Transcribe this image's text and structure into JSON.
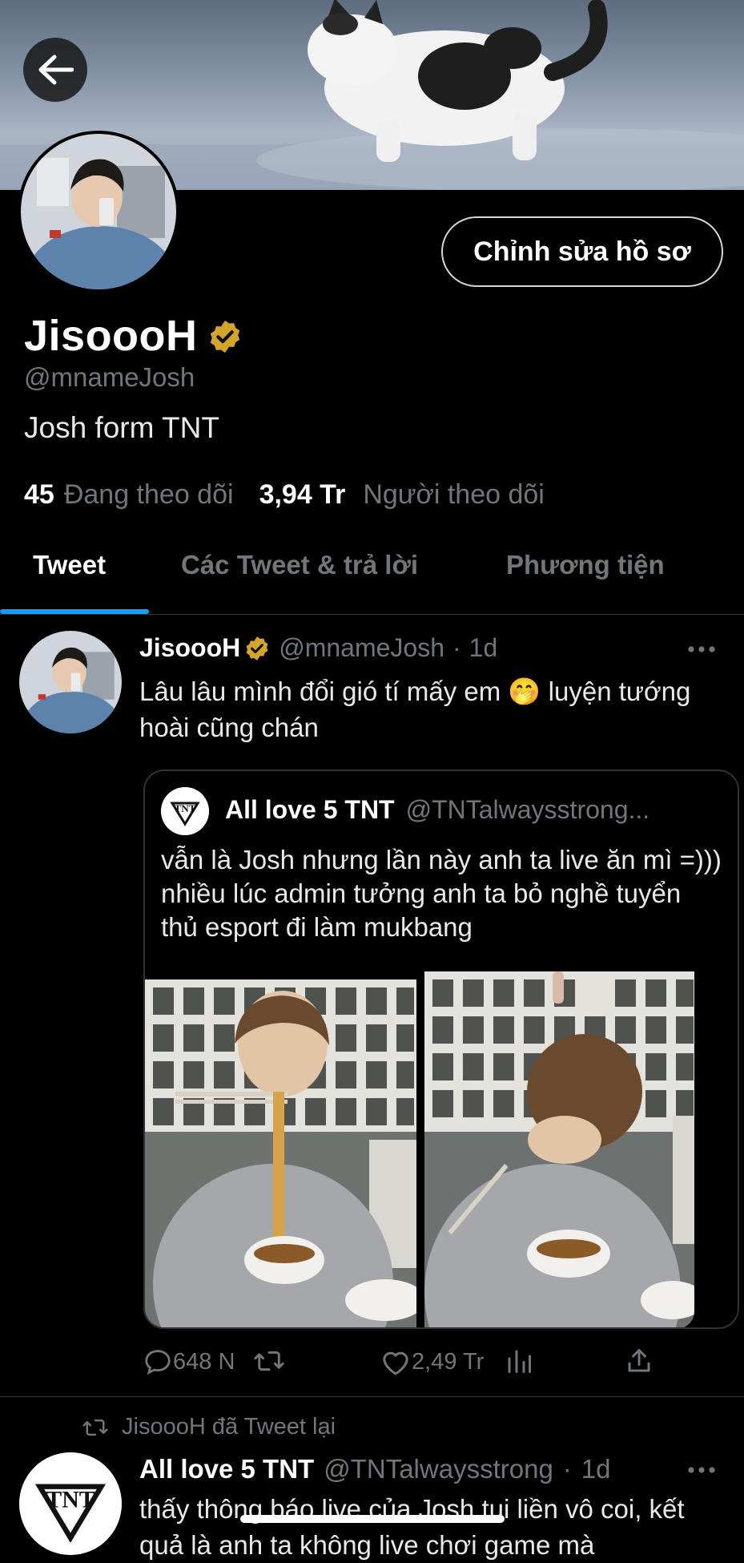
{
  "profile": {
    "display_name": "JisoooH",
    "handle": "@mnameJosh",
    "bio": "Josh form TNT",
    "following_count": "45",
    "following_label": "Đang theo dõi",
    "followers_count": "3,94 Tr",
    "followers_label": "Người theo dõi",
    "edit_button": "Chỉnh sửa hồ sơ",
    "verified_color": "#d4a52b"
  },
  "tabs": [
    {
      "label": "Tweet",
      "active": true
    },
    {
      "label": "Các Tweet & trả lời",
      "active": false
    },
    {
      "label": "Phương tiện",
      "active": false
    }
  ],
  "tweet": {
    "author_name": "JisoooH",
    "author_handle": "@mnameJosh",
    "separator": "·",
    "time": "1d",
    "text": "Lâu lâu mình đổi gió tí mấy em 🤭 luyện tướng hoài cũng chán",
    "quote": {
      "author_name": "All love 5 TNT",
      "author_handle": "@TNTalwaysstrong...",
      "avatar_text": "TNT",
      "text": "vẫn là Josh nhưng lần này anh ta live ăn mì =))) nhiều lúc admin tưởng anh ta bỏ nghề tuyển thủ esport đi làm mukbang"
    },
    "replies": "648 N",
    "likes": "2,49 Tr"
  },
  "retweet": {
    "label": "JisoooH đã Tweet lại",
    "author_name": "All love 5 TNT",
    "author_handle": "@TNTalwaysstrong",
    "separator": "·",
    "time": "1d",
    "text": "thấy thông báo live của Josh tui liền vô coi, kết quả là anh ta không live chơi game mà",
    "avatar_text": "TNT"
  },
  "colors": {
    "accent": "#1d9bf0",
    "muted": "#71767b",
    "background": "#000000"
  }
}
